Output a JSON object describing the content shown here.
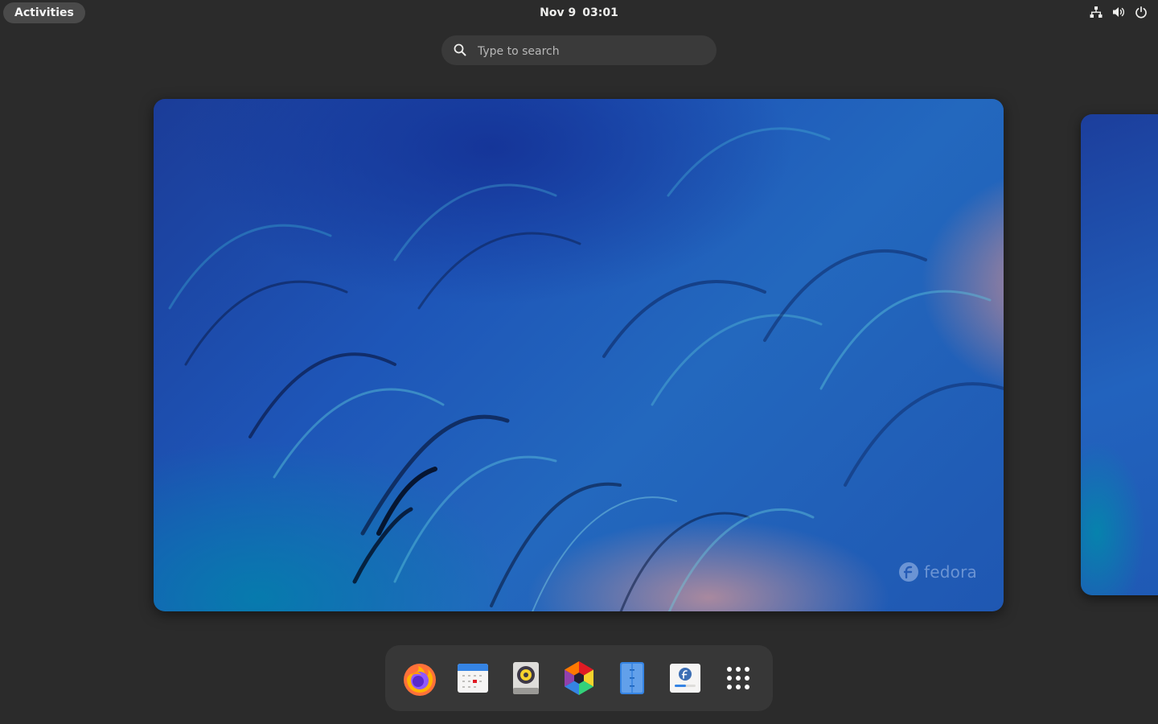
{
  "topbar": {
    "activities_label": "Activities",
    "date": "Nov 9",
    "time": "03:01",
    "tray_icons": [
      "network-wired-icon",
      "volume-icon",
      "power-icon"
    ]
  },
  "search": {
    "placeholder": "Type to search",
    "value": ""
  },
  "workspace": {
    "watermark_text": "fedora"
  },
  "dash": {
    "apps": [
      {
        "name": "Firefox",
        "icon": "firefox-icon"
      },
      {
        "name": "Calendar",
        "icon": "calendar-icon"
      },
      {
        "name": "Rhythmbox",
        "icon": "rhythmbox-icon"
      },
      {
        "name": "Software",
        "icon": "software-icon"
      },
      {
        "name": "Files",
        "icon": "files-icon"
      },
      {
        "name": "Fedora Media Writer",
        "icon": "fedora-media-writer-icon"
      },
      {
        "name": "Show Applications",
        "icon": "app-grid-icon"
      }
    ]
  },
  "colors": {
    "background": "#2b2b2b",
    "panel": "#373737",
    "accent_blue": "#3584e4"
  }
}
